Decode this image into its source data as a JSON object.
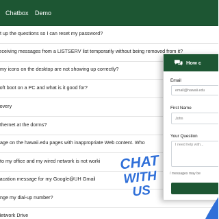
{
  "nav": {
    "chatbox_label": "Chatbox",
    "demo_label": "Demo",
    "background_color": "#1d5633"
  },
  "faq_items": [
    "et up the questions so I can reset my password?",
    " receiving messages from a LISTSERV list temporarily without being removed from it?",
    "f my icons on the desktop are not showing up correctly?",
    " soft boot on a PC and what is it good for?",
    "covery",
    "ethernet at the dorms?",
    "page on the hawaii.edu pages with inappropriate Web content. Who",
    "nto my office and my wired network is not worki",
    " vacation message for my Google@UH Gmail",
    "ange my dial-up number?",
    " Network Drive"
  ],
  "chat_panel": {
    "header_icon": "chat-bubbles-icon",
    "header_title": "How c",
    "email_label": "Email",
    "email_placeholder": "email@hawaii.edu",
    "first_name_label": "First Name",
    "first_name_placeholder": "John",
    "question_label": "Your Question",
    "question_placeholder": "I need help with...",
    "hint_text": "/ messages may be",
    "accent_color": "#1d5633"
  },
  "sticker": {
    "line1": "CHAT",
    "line2": "WITH",
    "line3": "US",
    "color": "#2f6fd8"
  }
}
